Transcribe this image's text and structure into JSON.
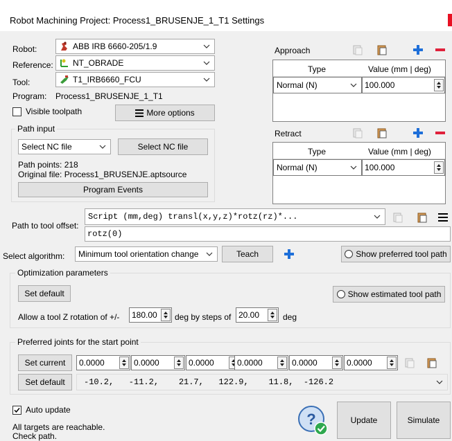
{
  "window": {
    "title": "Robot Machining Project: Process1_BRUSENJE_1_T1 Settings"
  },
  "robot": {
    "label": "Robot:",
    "value": "ABB IRB 6660-205/1.9"
  },
  "reference": {
    "label": "Reference:",
    "value": "NT_OBRADE"
  },
  "tool": {
    "label": "Tool:",
    "value": "T1_IRB6660_FCU"
  },
  "program": {
    "label": "Program:",
    "value": "Process1_BRUSENJE_1_T1"
  },
  "visible_toolpath": {
    "label": "Visible toolpath",
    "checked": false
  },
  "more_options": {
    "label": "More options"
  },
  "path_input": {
    "title": "Path input",
    "select_combo": "Select NC file",
    "select_button": "Select NC file",
    "points": "Path points: 218",
    "original_file": "Original file: Process1_BRUSENJE.aptsource",
    "events_button": "Program Events"
  },
  "approach": {
    "title": "Approach",
    "col_type": "Type",
    "col_value": "Value (mm | deg)",
    "type_value": "Normal (N)",
    "value": "100.000"
  },
  "retract": {
    "title": "Retract",
    "col_type": "Type",
    "col_value": "Value (mm | deg)",
    "type_value": "Normal (N)",
    "value": "100.000"
  },
  "offset": {
    "label": "Path to tool offset:",
    "script": "Script (mm,deg) transl(x,y,z)*rotz(rz)*...",
    "expr": "rotz(0)"
  },
  "algorithm": {
    "label": "Select algorithm:",
    "value": "Minimum tool orientation change",
    "teach": "Teach",
    "show_preferred": "Show preferred tool path"
  },
  "optimization": {
    "title": "Optimization parameters",
    "set_default": "Set default",
    "show_estimated": "Show estimated tool path",
    "allow_label": "Allow a tool Z rotation of +/-",
    "rotation": "180.00",
    "steps_label": "deg by steps of",
    "step": "20.00",
    "deg": "deg"
  },
  "preferred": {
    "title": "Preferred joints for the start point",
    "set_current": "Set current",
    "joints": [
      "0.0000",
      "0.0000",
      "0.0000",
      "0.0000",
      "0.0000",
      "0.0000"
    ],
    "set_default": "Set default",
    "default_values": "-10.2,   -11.2,    21.7,   122.9,    11.8,  -126.2"
  },
  "footer": {
    "auto_update": "Auto update",
    "auto_update_checked": true,
    "status_line1": "All targets are reachable.",
    "status_line2": "Check path.",
    "update": "Update",
    "simulate": "Simulate"
  },
  "colors": {
    "accent_blue": "#1e6fd9",
    "remove_red": "#e0213b",
    "close_red": "#e81123"
  }
}
